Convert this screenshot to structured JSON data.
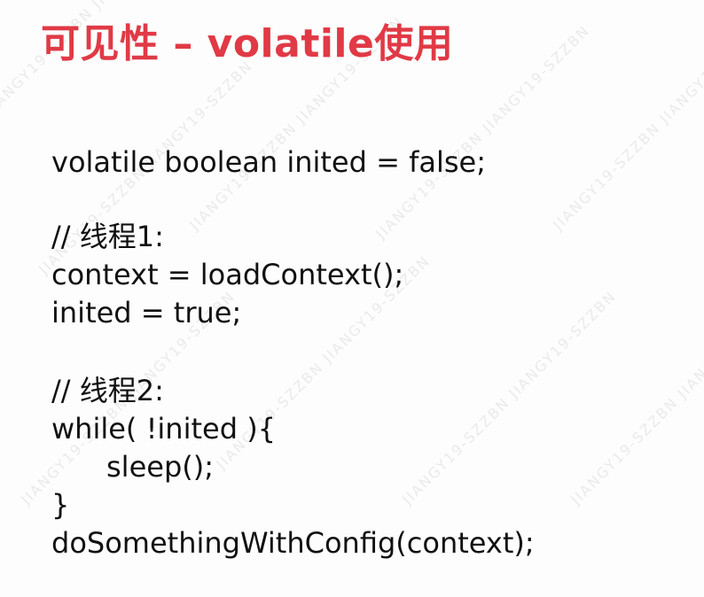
{
  "slide": {
    "title": "可见性 – volatile使用",
    "code_lines": [
      "volatile boolean inited = false;",
      "// 线程1:",
      "context = loadContext();",
      "inited = true;",
      "// 线程2:",
      "while( !inited ){",
      "sleep();",
      "}",
      "doSomethingWithConfig(context);"
    ]
  },
  "watermark": {
    "text": "JIANGY19-SZZBN"
  },
  "colors": {
    "title": "#e03a46",
    "text": "#111111",
    "background": "#fdfdfd"
  }
}
